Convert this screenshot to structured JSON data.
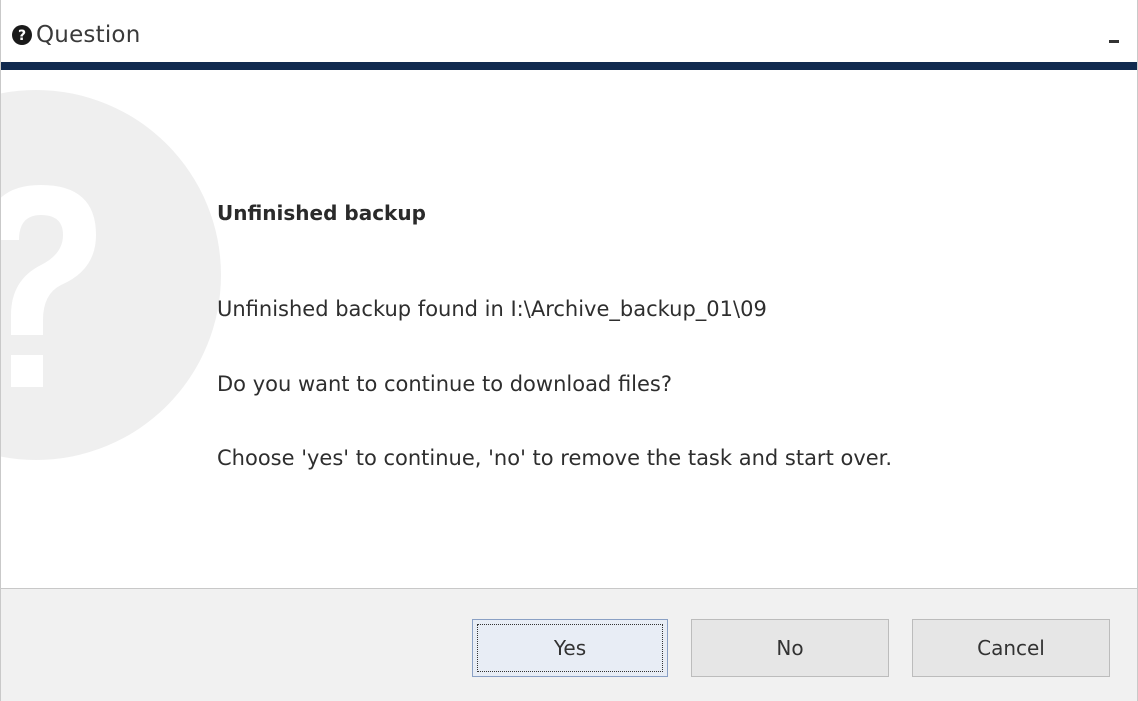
{
  "window": {
    "title": "Question",
    "icon": "question-circle-icon",
    "minimize_icon": "minimize-icon"
  },
  "colors": {
    "accent_bar": "#112a4f",
    "footer_bg": "#f1f1f1",
    "watermark": "#ececec"
  },
  "message": {
    "heading": "Unfinished backup",
    "line1": "Unfinished backup found in I:\\Archive_backup_01\\09",
    "line2": "Do you want to continue to download files?",
    "line3": "Choose 'yes' to continue, 'no' to remove the task and start over."
  },
  "buttons": {
    "yes": "Yes",
    "no": "No",
    "cancel": "Cancel"
  },
  "watermark_icon": "question-mark-icon"
}
